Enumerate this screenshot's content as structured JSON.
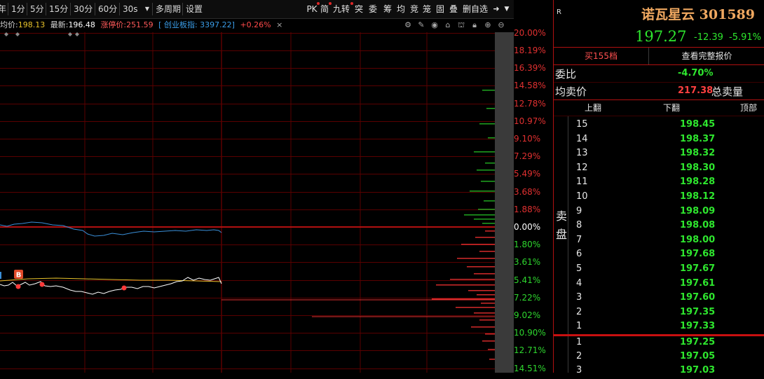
{
  "toolbar": {
    "period_tabs": [
      "年",
      "1分",
      "5分",
      "15分",
      "30分",
      "60分",
      "30s"
    ],
    "multi_period": "多周期",
    "settings": "设置",
    "right_tools": [
      "PK",
      "简",
      "九转",
      "突",
      "委",
      "筹",
      "均",
      "竞",
      "笼",
      "固",
      "叠",
      "删自选"
    ]
  },
  "info": {
    "avg_label": "均价:",
    "avg_value": "198.13",
    "latest_label": "最新:",
    "latest_value": "196.48",
    "limit_label": "涨停价:",
    "limit_value": "251.59",
    "index_text": "[ 创业板指: 3397.22]",
    "index_change": "+0.26%",
    "close": "×"
  },
  "markers": {
    "buy_label": "B"
  },
  "axis": {
    "up": [
      "20.00%",
      "18.19%",
      "16.39%",
      "14.58%",
      "12.78%",
      "10.97%",
      "9.10%",
      "7.29%",
      "5.49%",
      "3.68%",
      "1.88%"
    ],
    "zero": "0.00%",
    "down": [
      "1.80%",
      "3.61%",
      "5.41%",
      "7.22%",
      "9.02%",
      "10.90%",
      "12.71%",
      "14.51%"
    ]
  },
  "colors": {
    "up": "#e03030",
    "down": "#2ed62e",
    "avg_line": "#e8c22a",
    "price_line": "#ffffff",
    "index_line": "#3a8fd8",
    "grid": "#5a0000",
    "accent_red": "#c81010"
  },
  "panel": {
    "badge": "R",
    "name": "诺瓦星云",
    "code": "301589",
    "price": "197.27",
    "change": "-12.39",
    "change_pct": "-5.91%",
    "buy_btn": "买155档",
    "full_quote_btn": "查看完整报价",
    "weibi_label": "委比",
    "weibi_value": "-4.70%",
    "avg_sell_label": "均卖价",
    "avg_sell_value": "217.38",
    "total_sell_label": "总卖量",
    "nav": [
      "上翻",
      "下翻",
      "顶部"
    ],
    "sell_side_label": [
      "卖",
      "盘"
    ],
    "sell_levels": [
      {
        "level": "15",
        "price": "198.45"
      },
      {
        "level": "14",
        "price": "198.37"
      },
      {
        "level": "13",
        "price": "198.32"
      },
      {
        "level": "12",
        "price": "198.30"
      },
      {
        "level": "11",
        "price": "198.28"
      },
      {
        "level": "10",
        "price": "198.12"
      },
      {
        "level": "9",
        "price": "198.09"
      },
      {
        "level": "8",
        "price": "198.08"
      },
      {
        "level": "7",
        "price": "198.00"
      },
      {
        "level": "6",
        "price": "197.68"
      },
      {
        "level": "5",
        "price": "197.67"
      },
      {
        "level": "4",
        "price": "197.61"
      },
      {
        "level": "3",
        "price": "197.60"
      },
      {
        "level": "2",
        "price": "197.35"
      },
      {
        "level": "1",
        "price": "197.33"
      }
    ],
    "buy_levels": [
      {
        "level": "1",
        "price": "197.25"
      },
      {
        "level": "2",
        "price": "197.05"
      },
      {
        "level": "3",
        "price": "197.03"
      }
    ]
  }
}
